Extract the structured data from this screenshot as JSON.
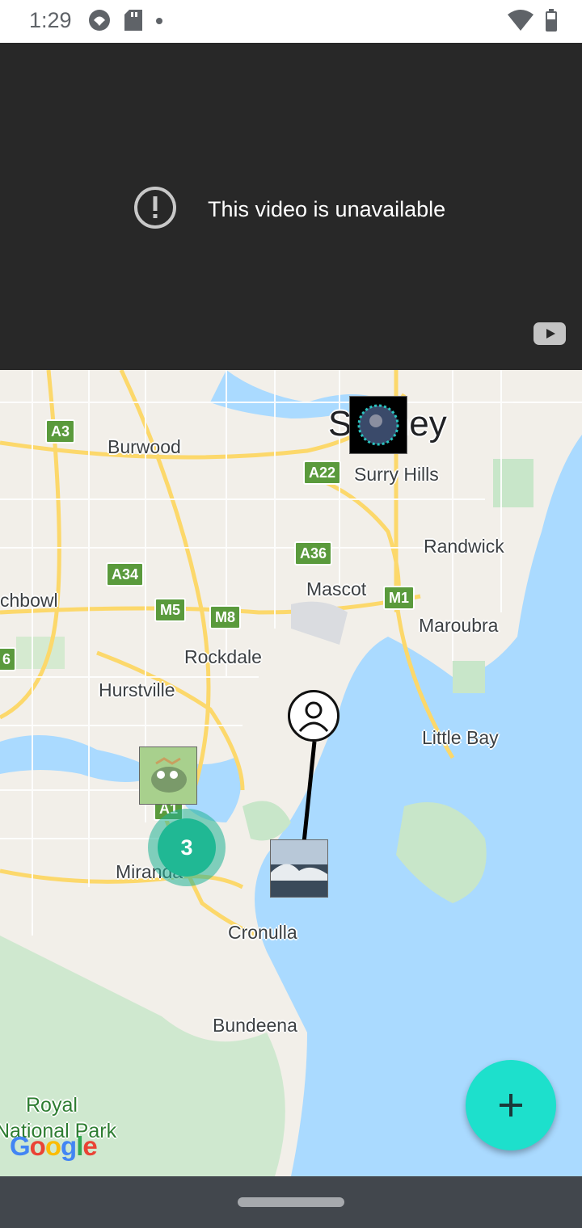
{
  "status_bar": {
    "time": "1:29",
    "left_icons": [
      "incognito-icon",
      "sd-card-icon",
      "dot-icon"
    ],
    "right_icons": [
      "wifi-icon",
      "battery-icon"
    ]
  },
  "video": {
    "message": "This video is unavailable",
    "icons": [
      "alert-circle-icon",
      "youtube-logo-icon"
    ]
  },
  "map": {
    "labels": {
      "sydney": "Sydney",
      "burwood": "Burwood",
      "surry_hills": "Surry Hills",
      "randwick": "Randwick",
      "mascot": "Mascot",
      "maroubra": "Maroubra",
      "chbowl": "chbowl",
      "rockdale": "Rockdale",
      "hurstville": "Hurstville",
      "little_bay": "Little Bay",
      "miranda": "Miranda",
      "cronulla": "Cronulla",
      "bundeena": "Bundeena",
      "royal": "Royal",
      "national_park": "National Park"
    },
    "shields": {
      "a3": "A3",
      "a22": "A22",
      "a36": "A36",
      "a34": "A34",
      "m5": "M5",
      "m8": "M8",
      "m1": "M1",
      "a1": "A1",
      "edge": "6"
    },
    "cluster_count": "3",
    "attribution": "Google",
    "colors": {
      "water": "#aadaff",
      "land": "#f2efe9",
      "park": "#c8e6c9",
      "road": "#fcd86b",
      "cluster": "#20b894"
    }
  },
  "fab": {
    "icon": "plus-icon",
    "color": "#1de0cc"
  },
  "nav_bar": {
    "icon": "home-handle"
  }
}
